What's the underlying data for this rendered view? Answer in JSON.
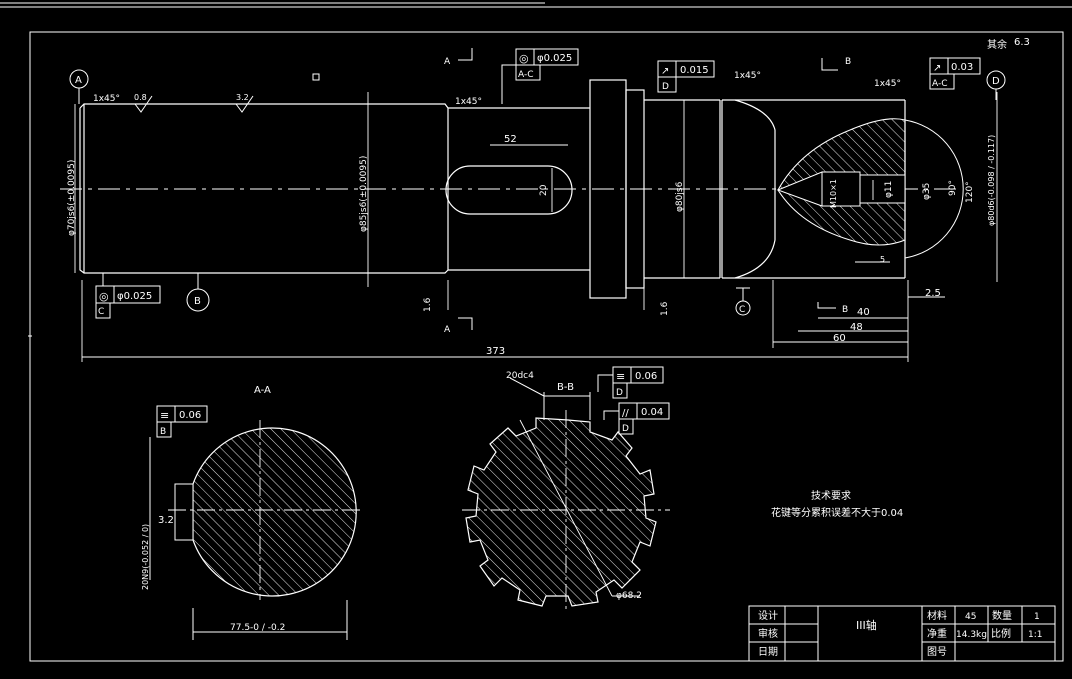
{
  "drawing": {
    "surface_note": "其余",
    "surface_value": "6.3",
    "datum_labels": [
      "A",
      "B",
      "C",
      "D"
    ],
    "section_marks": {
      "a_top": "A",
      "a_bottom": "A",
      "b_top": "B",
      "b_bottom": "B"
    },
    "chamfers": [
      "1x45°",
      "1x45°",
      "1x45°",
      "1x45°"
    ],
    "roughness": [
      "0.8",
      "3.2"
    ],
    "fits": {
      "d70": "φ70js6(±0.0095)",
      "d85": "φ85js6(±0.0095)",
      "d80": "φ80js6",
      "d80_tol": "φ80d6(-0.098 / -0.117)",
      "d35": "φ35",
      "d11": "φ11",
      "thread": "M10×1"
    },
    "feature_frames": [
      {
        "symbol": "◎",
        "value": "φ0.025",
        "datum": "A-C"
      },
      {
        "symbol": "↗",
        "value": "0.015",
        "datum": "D"
      },
      {
        "symbol": "↗",
        "value": "0.03",
        "datum": "A-C"
      },
      {
        "symbol": "◎",
        "value": "φ0.025",
        "datum": "C"
      }
    ],
    "dims": {
      "keyway_len": "52",
      "keyway_w": "20",
      "overall": "373",
      "d40": "40",
      "d48": "48",
      "d60": "60",
      "d2_5": "2.5",
      "r1_6a": "1.6",
      "r1_6b": "1.6",
      "angle": "120°",
      "angle2": "90°",
      "d5": "5"
    },
    "section_aa": {
      "title": "A-A",
      "frame_symbol": "≡",
      "frame_value": "0.06",
      "frame_datum": "B",
      "key_depth": "3.2",
      "key_width": "20N9(-0.052 / 0)",
      "dim_bottom": "77.5-0 / -0.2"
    },
    "section_bb": {
      "title": "B-B",
      "spline": "20dc4",
      "frame1_symbol": "≡",
      "frame1_value": "0.06",
      "frame1_datum": "D",
      "frame2_symbol": "//",
      "frame2_value": "0.04",
      "frame2_datum": "D",
      "dia": "φ68.2"
    },
    "tech_req_title": "技术要求",
    "tech_req_text": "花键等分累积误差不大于0.04"
  },
  "title_block": {
    "design": "设计",
    "review": "审核",
    "date": "日期",
    "part_name": "III轴",
    "material_label": "材料",
    "material": "45",
    "qty_label": "数量",
    "qty": "1",
    "weight_label": "净重",
    "weight": "14.3kg",
    "scale_label": "比例",
    "scale": "1:1",
    "drawing_no_label": "图号"
  }
}
